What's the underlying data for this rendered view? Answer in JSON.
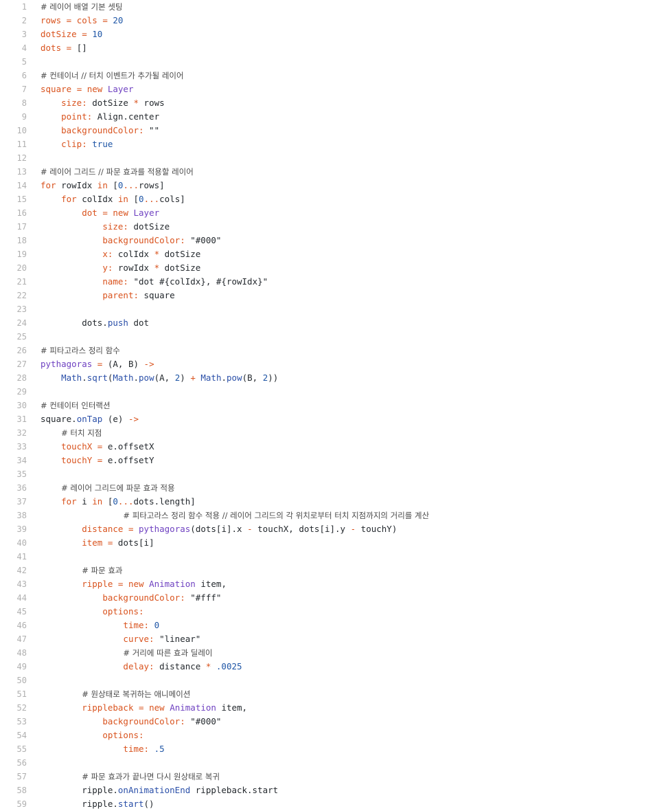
{
  "colors": {
    "default": "#24292e",
    "comment": "#4a4a4a",
    "property": "#d9531e",
    "number": "#1f56a6",
    "keyword": "#d9531e",
    "type": "#6f42c1",
    "function": "#2a4fa8",
    "operator": "#d9531e",
    "line_number": "#b0b0b0"
  },
  "lines": [
    {
      "n": "1",
      "tokens": [
        {
          "t": "cm",
          "v": "# 레이어 배열 기본 셋팅"
        }
      ]
    },
    {
      "n": "2",
      "tokens": [
        {
          "t": "p",
          "v": "rows"
        },
        {
          "t": "c",
          "v": " "
        },
        {
          "t": "o",
          "v": "="
        },
        {
          "t": "c",
          "v": " "
        },
        {
          "t": "p",
          "v": "cols"
        },
        {
          "t": "c",
          "v": " "
        },
        {
          "t": "o",
          "v": "="
        },
        {
          "t": "c",
          "v": " "
        },
        {
          "t": "n",
          "v": "20"
        }
      ]
    },
    {
      "n": "3",
      "tokens": [
        {
          "t": "p",
          "v": "dotSize"
        },
        {
          "t": "c",
          "v": " "
        },
        {
          "t": "o",
          "v": "="
        },
        {
          "t": "c",
          "v": " "
        },
        {
          "t": "n",
          "v": "10"
        }
      ]
    },
    {
      "n": "4",
      "tokens": [
        {
          "t": "p",
          "v": "dots"
        },
        {
          "t": "c",
          "v": " "
        },
        {
          "t": "o",
          "v": "="
        },
        {
          "t": "c",
          "v": " []"
        }
      ]
    },
    {
      "n": "5",
      "tokens": []
    },
    {
      "n": "6",
      "tokens": [
        {
          "t": "cm",
          "v": "# 컨테이너 // 터치 이벤트가 추가될 레이어"
        }
      ]
    },
    {
      "n": "7",
      "tokens": [
        {
          "t": "p",
          "v": "square"
        },
        {
          "t": "c",
          "v": " "
        },
        {
          "t": "o",
          "v": "="
        },
        {
          "t": "c",
          "v": " "
        },
        {
          "t": "k",
          "v": "new"
        },
        {
          "t": "c",
          "v": " "
        },
        {
          "t": "t",
          "v": "Layer"
        }
      ]
    },
    {
      "n": "8",
      "tokens": [
        {
          "t": "c",
          "v": "    "
        },
        {
          "t": "p",
          "v": "size:"
        },
        {
          "t": "c",
          "v": " dotSize "
        },
        {
          "t": "o",
          "v": "*"
        },
        {
          "t": "c",
          "v": " rows"
        }
      ]
    },
    {
      "n": "9",
      "tokens": [
        {
          "t": "c",
          "v": "    "
        },
        {
          "t": "p",
          "v": "point:"
        },
        {
          "t": "c",
          "v": " Align.center"
        }
      ]
    },
    {
      "n": "10",
      "tokens": [
        {
          "t": "c",
          "v": "    "
        },
        {
          "t": "p",
          "v": "backgroundColor:"
        },
        {
          "t": "c",
          "v": " \"\""
        }
      ]
    },
    {
      "n": "11",
      "tokens": [
        {
          "t": "c",
          "v": "    "
        },
        {
          "t": "p",
          "v": "clip:"
        },
        {
          "t": "c",
          "v": " "
        },
        {
          "t": "n",
          "v": "true"
        }
      ]
    },
    {
      "n": "12",
      "tokens": []
    },
    {
      "n": "13",
      "tokens": [
        {
          "t": "cm",
          "v": "# 레이어 그리드 // 파문 효과를 적용할 레이어"
        }
      ]
    },
    {
      "n": "14",
      "tokens": [
        {
          "t": "k",
          "v": "for"
        },
        {
          "t": "c",
          "v": " rowIdx "
        },
        {
          "t": "k",
          "v": "in"
        },
        {
          "t": "c",
          "v": " ["
        },
        {
          "t": "n",
          "v": "0"
        },
        {
          "t": "o",
          "v": "..."
        },
        {
          "t": "c",
          "v": "rows]"
        }
      ]
    },
    {
      "n": "15",
      "tokens": [
        {
          "t": "c",
          "v": "    "
        },
        {
          "t": "k",
          "v": "for"
        },
        {
          "t": "c",
          "v": " colIdx "
        },
        {
          "t": "k",
          "v": "in"
        },
        {
          "t": "c",
          "v": " ["
        },
        {
          "t": "n",
          "v": "0"
        },
        {
          "t": "o",
          "v": "..."
        },
        {
          "t": "c",
          "v": "cols]"
        }
      ]
    },
    {
      "n": "16",
      "tokens": [
        {
          "t": "c",
          "v": "        "
        },
        {
          "t": "p",
          "v": "dot"
        },
        {
          "t": "c",
          "v": " "
        },
        {
          "t": "o",
          "v": "="
        },
        {
          "t": "c",
          "v": " "
        },
        {
          "t": "k",
          "v": "new"
        },
        {
          "t": "c",
          "v": " "
        },
        {
          "t": "t",
          "v": "Layer"
        }
      ]
    },
    {
      "n": "17",
      "tokens": [
        {
          "t": "c",
          "v": "            "
        },
        {
          "t": "p",
          "v": "size:"
        },
        {
          "t": "c",
          "v": " dotSize"
        }
      ]
    },
    {
      "n": "18",
      "tokens": [
        {
          "t": "c",
          "v": "            "
        },
        {
          "t": "p",
          "v": "backgroundColor:"
        },
        {
          "t": "c",
          "v": " \"#000\""
        }
      ]
    },
    {
      "n": "19",
      "tokens": [
        {
          "t": "c",
          "v": "            "
        },
        {
          "t": "p",
          "v": "x:"
        },
        {
          "t": "c",
          "v": " colIdx "
        },
        {
          "t": "o",
          "v": "*"
        },
        {
          "t": "c",
          "v": " dotSize"
        }
      ]
    },
    {
      "n": "20",
      "tokens": [
        {
          "t": "c",
          "v": "            "
        },
        {
          "t": "p",
          "v": "y:"
        },
        {
          "t": "c",
          "v": " rowIdx "
        },
        {
          "t": "o",
          "v": "*"
        },
        {
          "t": "c",
          "v": " dotSize"
        }
      ]
    },
    {
      "n": "21",
      "tokens": [
        {
          "t": "c",
          "v": "            "
        },
        {
          "t": "p",
          "v": "name:"
        },
        {
          "t": "c",
          "v": " \"dot #{colIdx}, #{rowIdx}\""
        }
      ]
    },
    {
      "n": "22",
      "tokens": [
        {
          "t": "c",
          "v": "            "
        },
        {
          "t": "p",
          "v": "parent:"
        },
        {
          "t": "c",
          "v": " square"
        }
      ]
    },
    {
      "n": "23",
      "tokens": []
    },
    {
      "n": "24",
      "tokens": [
        {
          "t": "c",
          "v": "        dots."
        },
        {
          "t": "f",
          "v": "push"
        },
        {
          "t": "c",
          "v": " dot"
        }
      ]
    },
    {
      "n": "25",
      "tokens": []
    },
    {
      "n": "26",
      "tokens": [
        {
          "t": "cm",
          "v": "# 피타고라스 정리 함수"
        }
      ]
    },
    {
      "n": "27",
      "tokens": [
        {
          "t": "t",
          "v": "pythagoras"
        },
        {
          "t": "c",
          "v": " "
        },
        {
          "t": "o",
          "v": "="
        },
        {
          "t": "c",
          "v": " (A, B) "
        },
        {
          "t": "o",
          "v": "->"
        }
      ]
    },
    {
      "n": "28",
      "tokens": [
        {
          "t": "c",
          "v": "    "
        },
        {
          "t": "f",
          "v": "Math"
        },
        {
          "t": "c",
          "v": "."
        },
        {
          "t": "f",
          "v": "sqrt"
        },
        {
          "t": "c",
          "v": "("
        },
        {
          "t": "f",
          "v": "Math"
        },
        {
          "t": "c",
          "v": "."
        },
        {
          "t": "f",
          "v": "pow"
        },
        {
          "t": "c",
          "v": "(A, "
        },
        {
          "t": "n",
          "v": "2"
        },
        {
          "t": "c",
          "v": ") "
        },
        {
          "t": "o",
          "v": "+"
        },
        {
          "t": "c",
          "v": " "
        },
        {
          "t": "f",
          "v": "Math"
        },
        {
          "t": "c",
          "v": "."
        },
        {
          "t": "f",
          "v": "pow"
        },
        {
          "t": "c",
          "v": "(B, "
        },
        {
          "t": "n",
          "v": "2"
        },
        {
          "t": "c",
          "v": "))"
        }
      ]
    },
    {
      "n": "29",
      "tokens": []
    },
    {
      "n": "30",
      "tokens": [
        {
          "t": "cm",
          "v": "# 컨테이터 인터랙션"
        }
      ]
    },
    {
      "n": "31",
      "tokens": [
        {
          "t": "c",
          "v": "square."
        },
        {
          "t": "f",
          "v": "onTap"
        },
        {
          "t": "c",
          "v": " (e) "
        },
        {
          "t": "o",
          "v": "->"
        }
      ]
    },
    {
      "n": "32",
      "tokens": [
        {
          "t": "c",
          "v": "    "
        },
        {
          "t": "cm",
          "v": "# 터치 지점"
        }
      ]
    },
    {
      "n": "33",
      "tokens": [
        {
          "t": "c",
          "v": "    "
        },
        {
          "t": "p",
          "v": "touchX"
        },
        {
          "t": "c",
          "v": " "
        },
        {
          "t": "o",
          "v": "="
        },
        {
          "t": "c",
          "v": " e.offsetX"
        }
      ]
    },
    {
      "n": "34",
      "tokens": [
        {
          "t": "c",
          "v": "    "
        },
        {
          "t": "p",
          "v": "touchY"
        },
        {
          "t": "c",
          "v": " "
        },
        {
          "t": "o",
          "v": "="
        },
        {
          "t": "c",
          "v": " e.offsetY"
        }
      ]
    },
    {
      "n": "35",
      "tokens": []
    },
    {
      "n": "36",
      "tokens": [
        {
          "t": "c",
          "v": "    "
        },
        {
          "t": "cm",
          "v": "# 레이어 그리드에 파문 효과 적용"
        }
      ]
    },
    {
      "n": "37",
      "tokens": [
        {
          "t": "c",
          "v": "    "
        },
        {
          "t": "k",
          "v": "for"
        },
        {
          "t": "c",
          "v": " i "
        },
        {
          "t": "k",
          "v": "in"
        },
        {
          "t": "c",
          "v": " ["
        },
        {
          "t": "n",
          "v": "0"
        },
        {
          "t": "o",
          "v": "..."
        },
        {
          "t": "c",
          "v": "dots.length]"
        }
      ]
    },
    {
      "n": "38",
      "tokens": [
        {
          "t": "c",
          "v": "                "
        },
        {
          "t": "cm",
          "v": "# 피타고라스 정리 함수 적용 // 레이어 그리드의 각 위치로부터 터치 지점까지의 거리를 계산"
        }
      ]
    },
    {
      "n": "39",
      "tokens": [
        {
          "t": "c",
          "v": "        "
        },
        {
          "t": "p",
          "v": "distance"
        },
        {
          "t": "c",
          "v": " "
        },
        {
          "t": "o",
          "v": "="
        },
        {
          "t": "c",
          "v": " "
        },
        {
          "t": "t",
          "v": "pythagoras"
        },
        {
          "t": "c",
          "v": "(dots[i].x "
        },
        {
          "t": "o",
          "v": "-"
        },
        {
          "t": "c",
          "v": " touchX, dots[i].y "
        },
        {
          "t": "o",
          "v": "-"
        },
        {
          "t": "c",
          "v": " touchY)"
        }
      ]
    },
    {
      "n": "40",
      "tokens": [
        {
          "t": "c",
          "v": "        "
        },
        {
          "t": "p",
          "v": "item"
        },
        {
          "t": "c",
          "v": " "
        },
        {
          "t": "o",
          "v": "="
        },
        {
          "t": "c",
          "v": " dots[i]"
        }
      ]
    },
    {
      "n": "41",
      "tokens": []
    },
    {
      "n": "42",
      "tokens": [
        {
          "t": "c",
          "v": "        "
        },
        {
          "t": "cm",
          "v": "# 파문 효과"
        }
      ]
    },
    {
      "n": "43",
      "tokens": [
        {
          "t": "c",
          "v": "        "
        },
        {
          "t": "p",
          "v": "ripple"
        },
        {
          "t": "c",
          "v": " "
        },
        {
          "t": "o",
          "v": "="
        },
        {
          "t": "c",
          "v": " "
        },
        {
          "t": "k",
          "v": "new"
        },
        {
          "t": "c",
          "v": " "
        },
        {
          "t": "t",
          "v": "Animation"
        },
        {
          "t": "c",
          "v": " item,"
        }
      ]
    },
    {
      "n": "44",
      "tokens": [
        {
          "t": "c",
          "v": "            "
        },
        {
          "t": "p",
          "v": "backgroundColor:"
        },
        {
          "t": "c",
          "v": " \"#fff\""
        }
      ]
    },
    {
      "n": "45",
      "tokens": [
        {
          "t": "c",
          "v": "            "
        },
        {
          "t": "p",
          "v": "options:"
        }
      ]
    },
    {
      "n": "46",
      "tokens": [
        {
          "t": "c",
          "v": "                "
        },
        {
          "t": "p",
          "v": "time:"
        },
        {
          "t": "c",
          "v": " "
        },
        {
          "t": "n",
          "v": "0"
        }
      ]
    },
    {
      "n": "47",
      "tokens": [
        {
          "t": "c",
          "v": "                "
        },
        {
          "t": "p",
          "v": "curve:"
        },
        {
          "t": "c",
          "v": " \"linear\""
        }
      ]
    },
    {
      "n": "48",
      "tokens": [
        {
          "t": "c",
          "v": "                "
        },
        {
          "t": "cm",
          "v": "# 거리에 따른 효과 딜레이"
        }
      ]
    },
    {
      "n": "49",
      "tokens": [
        {
          "t": "c",
          "v": "                "
        },
        {
          "t": "p",
          "v": "delay:"
        },
        {
          "t": "c",
          "v": " distance "
        },
        {
          "t": "o",
          "v": "*"
        },
        {
          "t": "c",
          "v": " "
        },
        {
          "t": "n",
          "v": ".0025"
        }
      ]
    },
    {
      "n": "50",
      "tokens": []
    },
    {
      "n": "51",
      "tokens": [
        {
          "t": "c",
          "v": "        "
        },
        {
          "t": "cm",
          "v": "# 원상태로 복귀하는 애니메이션"
        }
      ]
    },
    {
      "n": "52",
      "tokens": [
        {
          "t": "c",
          "v": "        "
        },
        {
          "t": "p",
          "v": "rippleback"
        },
        {
          "t": "c",
          "v": " "
        },
        {
          "t": "o",
          "v": "="
        },
        {
          "t": "c",
          "v": " "
        },
        {
          "t": "k",
          "v": "new"
        },
        {
          "t": "c",
          "v": " "
        },
        {
          "t": "t",
          "v": "Animation"
        },
        {
          "t": "c",
          "v": " item,"
        }
      ]
    },
    {
      "n": "53",
      "tokens": [
        {
          "t": "c",
          "v": "            "
        },
        {
          "t": "p",
          "v": "backgroundColor:"
        },
        {
          "t": "c",
          "v": " \"#000\""
        }
      ]
    },
    {
      "n": "54",
      "tokens": [
        {
          "t": "c",
          "v": "            "
        },
        {
          "t": "p",
          "v": "options:"
        }
      ]
    },
    {
      "n": "55",
      "tokens": [
        {
          "t": "c",
          "v": "                "
        },
        {
          "t": "p",
          "v": "time:"
        },
        {
          "t": "c",
          "v": " "
        },
        {
          "t": "n",
          "v": ".5"
        }
      ]
    },
    {
      "n": "56",
      "tokens": []
    },
    {
      "n": "57",
      "tokens": [
        {
          "t": "c",
          "v": "        "
        },
        {
          "t": "cm",
          "v": "# 파문 효과가 끝나면 다시 원상태로 복귀"
        }
      ]
    },
    {
      "n": "58",
      "tokens": [
        {
          "t": "c",
          "v": "        ripple."
        },
        {
          "t": "f",
          "v": "onAnimationEnd"
        },
        {
          "t": "c",
          "v": " rippleback.start"
        }
      ]
    },
    {
      "n": "59",
      "tokens": [
        {
          "t": "c",
          "v": "        ripple."
        },
        {
          "t": "f",
          "v": "start"
        },
        {
          "t": "c",
          "v": "()"
        }
      ]
    }
  ]
}
